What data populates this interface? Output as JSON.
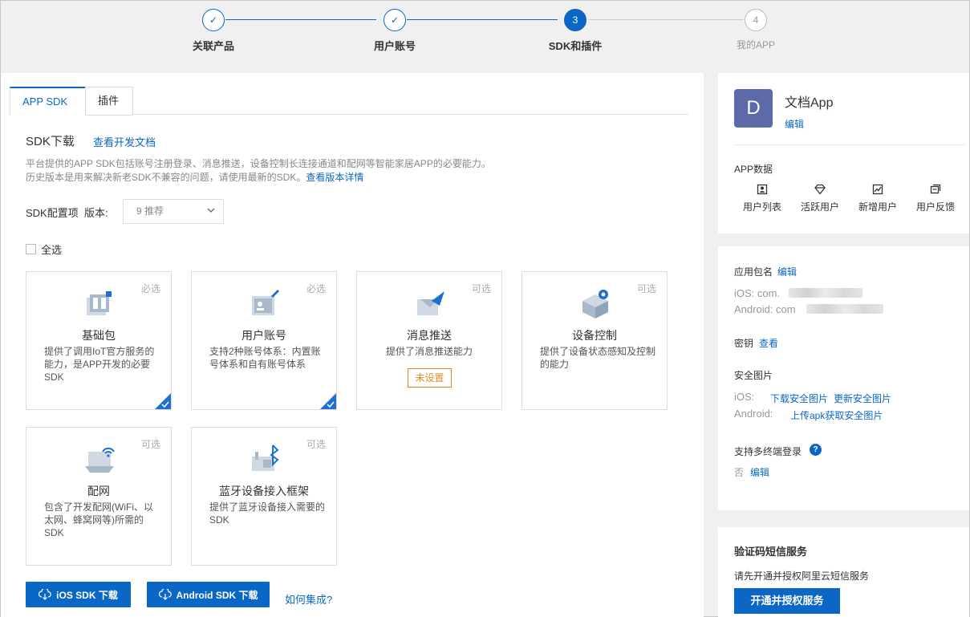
{
  "steps": [
    {
      "num": "✓",
      "label": "关联产品",
      "state": "done"
    },
    {
      "num": "✓",
      "label": "用户账号",
      "state": "done"
    },
    {
      "num": "3",
      "label": "SDK和插件",
      "state": "active"
    },
    {
      "num": "4",
      "label": "我的APP",
      "state": "todo"
    }
  ],
  "tabs": [
    "APP SDK",
    "插件"
  ],
  "sdk": {
    "title": "SDK下载",
    "doc_link": "查看开发文档",
    "desc1": "平台提供的APP SDK包括账号注册登录、消息推送，设备控制长连接通道和配网等智能家居APP的必要能力。",
    "desc2": "历史版本是用来解决新老SDK不兼容的问题，请使用最新的SDK。",
    "desc2_link": "查看版本详情",
    "config_label": "SDK配置项",
    "version_label": "版本:",
    "version_value": "9 推荐",
    "select_all": "全选"
  },
  "cards": [
    {
      "name": "基础包",
      "tag": "必选",
      "desc": "提供了调用IoT官方服务的能力，是APP开发的必要SDK",
      "checked": true
    },
    {
      "name": "用户账号",
      "tag": "必选",
      "desc": "支持2种账号体系：内置账号体系和自有账号体系",
      "checked": true
    },
    {
      "name": "消息推送",
      "tag": "可选",
      "desc": "提供了消息推送能力",
      "badge": "未设置"
    },
    {
      "name": "设备控制",
      "tag": "可选",
      "desc": "提供了设备状态感知及控制的能力"
    },
    {
      "name": "配网",
      "tag": "可选",
      "desc": "包含了开发配网(WiFi、以太网、蜂窝网等)所需的SDK"
    },
    {
      "name": "蓝牙设备接入框架",
      "tag": "可选",
      "desc": "提供了蓝牙设备接入需要的SDK"
    }
  ],
  "buttons": {
    "ios": "iOS SDK 下载",
    "android": "Android SDK 下载",
    "howto": "如何集成?"
  },
  "app": {
    "avatar_letter": "D",
    "name": "文档App",
    "edit": "编辑",
    "data_title": "APP数据",
    "stats": [
      "用户列表",
      "活跃用户",
      "新增用户",
      "用户反馈"
    ]
  },
  "info": {
    "package_label": "应用包名",
    "package_edit": "编辑",
    "ios_prefix": "iOS: com.",
    "android_prefix": "Android: com",
    "key_label": "密钥",
    "key_view": "查看",
    "security_label": "安全图片",
    "ios_label": "iOS:",
    "ios_download": "下载安全图片",
    "ios_update": "更新安全图片",
    "android_label": "Android:",
    "android_upload": "上传apk获取安全图片",
    "multi_login_label": "支持多终端登录",
    "multi_login_value": "否",
    "multi_login_edit": "编辑"
  },
  "sms": {
    "title": "验证码短信服务",
    "desc": "请先开通并授权阿里云短信服务",
    "button": "开通并授权服务"
  }
}
